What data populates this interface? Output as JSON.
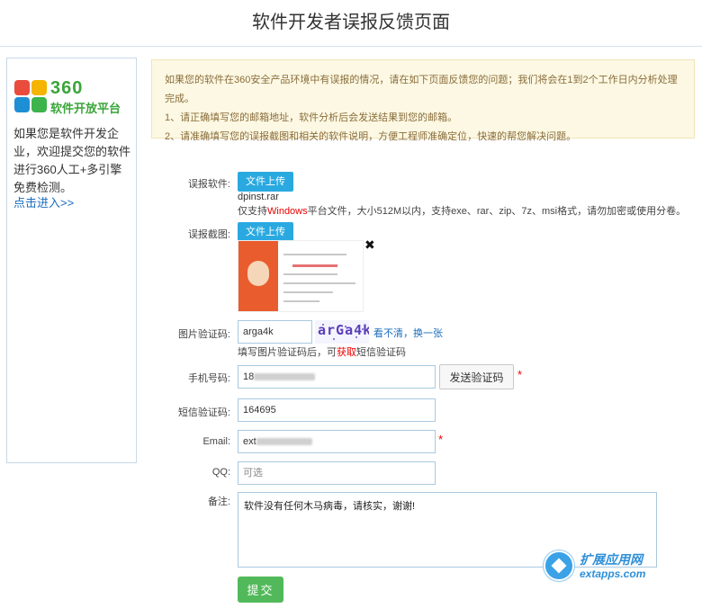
{
  "page": {
    "title": "软件开发者误报反馈页面"
  },
  "sidebar": {
    "logo_number": "360",
    "logo_subtitle": "软件开放平台",
    "description": "如果您是软件开发企业，欢迎提交您的软件进行360人工+多引擎免费检测。",
    "link": "点击进入>>"
  },
  "notice": {
    "line1": "如果您的软件在360安全产品环境中有误报的情况，请在如下页面反馈您的问题；我们将会在1到2个工作日内分析处理完成。",
    "line2": "1、请正确填写您的邮箱地址，软件分析后会发送结果到您的邮箱。",
    "line3": "2、请准确填写您的误报截图和相关的软件说明，方便工程师准确定位，快速的帮您解决问题。"
  },
  "form": {
    "software": {
      "label": "误报软件:",
      "upload_label": "文件上传",
      "file_name": "dpinst.rar",
      "hint_before": "仅支持",
      "hint_red": "Windows",
      "hint_after": "平台文件，大小512M以内，支持exe、rar、zip、7z、msi格式，请勿加密或使用分卷。"
    },
    "screenshot": {
      "label": "误报截图:",
      "upload_label": "文件上传",
      "close": "✖"
    },
    "captcha": {
      "label": "图片验证码:",
      "value": "arga4k",
      "image_text": "arGa4k",
      "refresh_link": "看不清，换一张",
      "hint_before": "填写图片验证码后，可",
      "hint_red": "获取",
      "hint_after": "短信验证码"
    },
    "phone": {
      "label": "手机号码:",
      "value_visible": "18",
      "send_button": "发送验证码",
      "required": "*"
    },
    "sms_code": {
      "label": "短信验证码:",
      "value": "164695"
    },
    "email": {
      "label": "Email:",
      "value_visible": "ext",
      "required": "*"
    },
    "qq": {
      "label": "QQ:",
      "placeholder": "可选"
    },
    "remark": {
      "label": "备注:",
      "value": "软件没有任何木马病毒，请核实，谢谢!"
    },
    "submit_label": "提交"
  },
  "watermark": {
    "title": "扩展应用网",
    "subtitle": "extapps.com"
  },
  "colors": {
    "upload_blue": "#2aa9e0",
    "submit_green": "#52b95a",
    "notice_bg": "#fcf8e3",
    "link_blue": "#1a6dbd",
    "required_red": "#e00000"
  }
}
